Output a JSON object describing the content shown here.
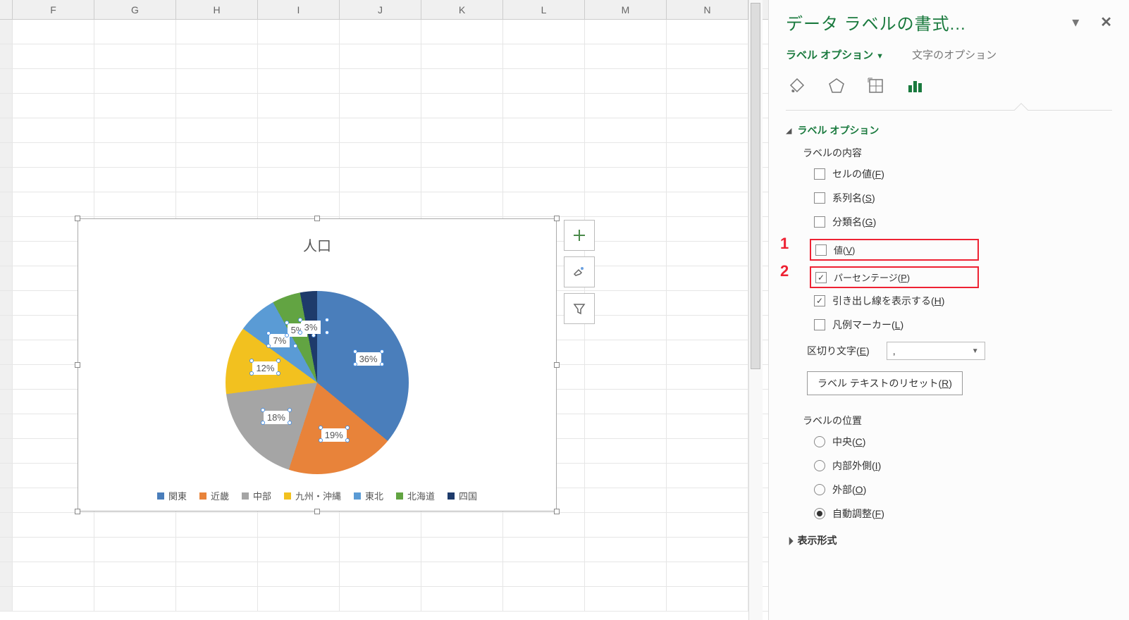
{
  "columns": [
    "F",
    "G",
    "H",
    "I",
    "J",
    "K",
    "L",
    "M",
    "N"
  ],
  "chart_data": {
    "type": "pie",
    "title": "人口",
    "series": [
      {
        "name": "関東",
        "value": 36,
        "color": "#4a7ebb"
      },
      {
        "name": "近畿",
        "value": 19,
        "color": "#e8833a"
      },
      {
        "name": "中部",
        "value": 18,
        "color": "#a5a5a5"
      },
      {
        "name": "九州・沖縄",
        "value": 12,
        "color": "#f2c11f"
      },
      {
        "name": "東北",
        "value": 7,
        "color": "#5a9bd5"
      },
      {
        "name": "北海道",
        "value": 5,
        "color": "#62a442"
      },
      {
        "name": "四国",
        "value": 3,
        "color": "#1e3b6b"
      }
    ]
  },
  "chart_buttons": {
    "plus": "+",
    "brush": "brush",
    "filter": "filter"
  },
  "pane": {
    "title": "データ ラベルの書式...",
    "tabs": {
      "label_options": "ラベル オプション",
      "text_options": "文字のオプション"
    },
    "section_label_options": "ラベル オプション",
    "sub_label_content": "ラベルの内容",
    "checks": {
      "cell_value": "セルの値(F)",
      "series_name": "系列名(S)",
      "category_name": "分類名(G)",
      "value": "値(V)",
      "percentage": "パーセンテージ(P)",
      "leader_lines": "引き出し線を表示する(H)",
      "legend_marker": "凡例マーカー(L)"
    },
    "separator_label": "区切り文字(E)",
    "separator_value": ",",
    "reset_label": "ラベル テキストのリセット(R)",
    "sub_label_position": "ラベルの位置",
    "radios": {
      "center": "中央(C)",
      "inside_end": "内部外側(I)",
      "outside_end": "外部(O)",
      "best_fit": "自動調整(F)"
    },
    "section_number_format": "表示形式"
  },
  "callouts": {
    "one": "1",
    "two": "2"
  }
}
